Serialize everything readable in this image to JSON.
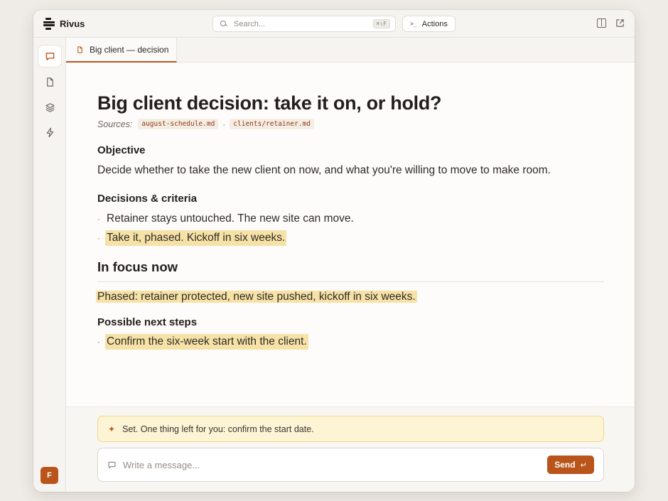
{
  "app": {
    "name": "Rivus"
  },
  "search": {
    "placeholder": "Search...",
    "shortcut": "⌘⇧F"
  },
  "toolbar": {
    "actions_label": "Actions",
    "actions_glyph": ">_"
  },
  "sidebar": {
    "items": [
      {
        "id": "chat",
        "icon": "chat-icon",
        "active": true
      },
      {
        "id": "documents",
        "icon": "document-icon",
        "active": false
      },
      {
        "id": "layers",
        "icon": "layers-icon",
        "active": false
      },
      {
        "id": "automations",
        "icon": "bolt-icon",
        "active": false
      }
    ],
    "avatar_initial": "F"
  },
  "tab": {
    "label": "Big client — decision"
  },
  "document": {
    "title": "Big client decision: take it on, or hold?",
    "sources_label": "Sources:",
    "sources": [
      "august-schedule.md",
      "clients/retainer.md"
    ],
    "source_separator": "·",
    "objective_heading": "Objective",
    "objective_text": "Decide whether to take the new client on now, and what you're willing to move to make room.",
    "decisions_heading": "Decisions & criteria",
    "decisions": [
      "Retainer stays untouched. The new site can move.",
      "Take it, phased. Kickoff in six weeks."
    ],
    "focus_heading": "In focus now",
    "focus_text": "Phased: retainer protected, new site pushed, kickoff in six weeks.",
    "next_heading": "Possible next steps",
    "next_steps": [
      "Confirm the six-week start with the client."
    ],
    "bullet_glyph": "·"
  },
  "notice": {
    "text": "Set. One thing left for you: confirm the start date."
  },
  "composer": {
    "placeholder": "Write a message...",
    "send_label": "Send"
  },
  "colors": {
    "accent": "#b9541a",
    "highlight": "#f6e2a6",
    "notice_bg": "#fdf4d6"
  }
}
